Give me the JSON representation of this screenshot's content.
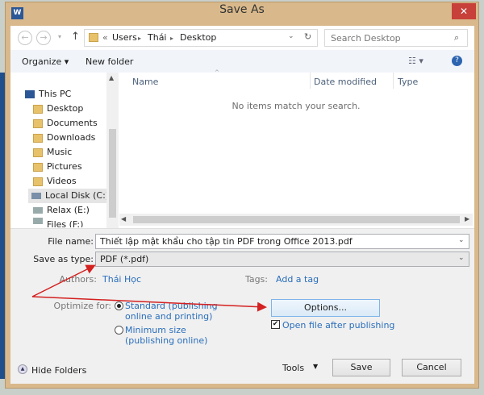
{
  "window": {
    "title": "Save As",
    "close": "✕",
    "app_icon": "W"
  },
  "nav": {
    "back": "←",
    "forward": "→",
    "up": "↑",
    "breadcrumb": [
      "«",
      "Users",
      "Thái",
      "Desktop"
    ],
    "search_placeholder": "Search Desktop"
  },
  "toolbar": {
    "organize": "Organize ▾",
    "new_folder": "New folder"
  },
  "sidebar": {
    "items": [
      {
        "label": "This PC"
      },
      {
        "label": "Desktop"
      },
      {
        "label": "Documents"
      },
      {
        "label": "Downloads"
      },
      {
        "label": "Music"
      },
      {
        "label": "Pictures"
      },
      {
        "label": "Videos"
      },
      {
        "label": "Local Disk (C:)"
      },
      {
        "label": "Relax (E:)"
      },
      {
        "label": "Files (F:)"
      }
    ]
  },
  "list": {
    "columns": [
      "Name",
      "Date modified",
      "Type"
    ],
    "empty": "No items match your search."
  },
  "form": {
    "file_name_label": "File name:",
    "file_name": "Thiết lập mật khẩu cho tập tin PDF trong Office 2013.pdf",
    "type_label": "Save as type:",
    "type": "PDF (*.pdf)",
    "authors_label": "Authors:",
    "authors": "Thái Học",
    "tags_label": "Tags:",
    "tags": "Add a tag",
    "optimize_label": "Optimize for:",
    "opt1a": "Standard (publishing",
    "opt1b": "online and printing)",
    "opt2a": "Minimum size",
    "opt2b": "(publishing online)",
    "options": "Options...",
    "open_after": "Open file after publishing"
  },
  "footer": {
    "hide_folders": "Hide Folders",
    "tools": "Tools",
    "save": "Save",
    "cancel": "Cancel"
  },
  "colors": {
    "accent": "#2a6ebb",
    "annotation": "#d42020"
  }
}
